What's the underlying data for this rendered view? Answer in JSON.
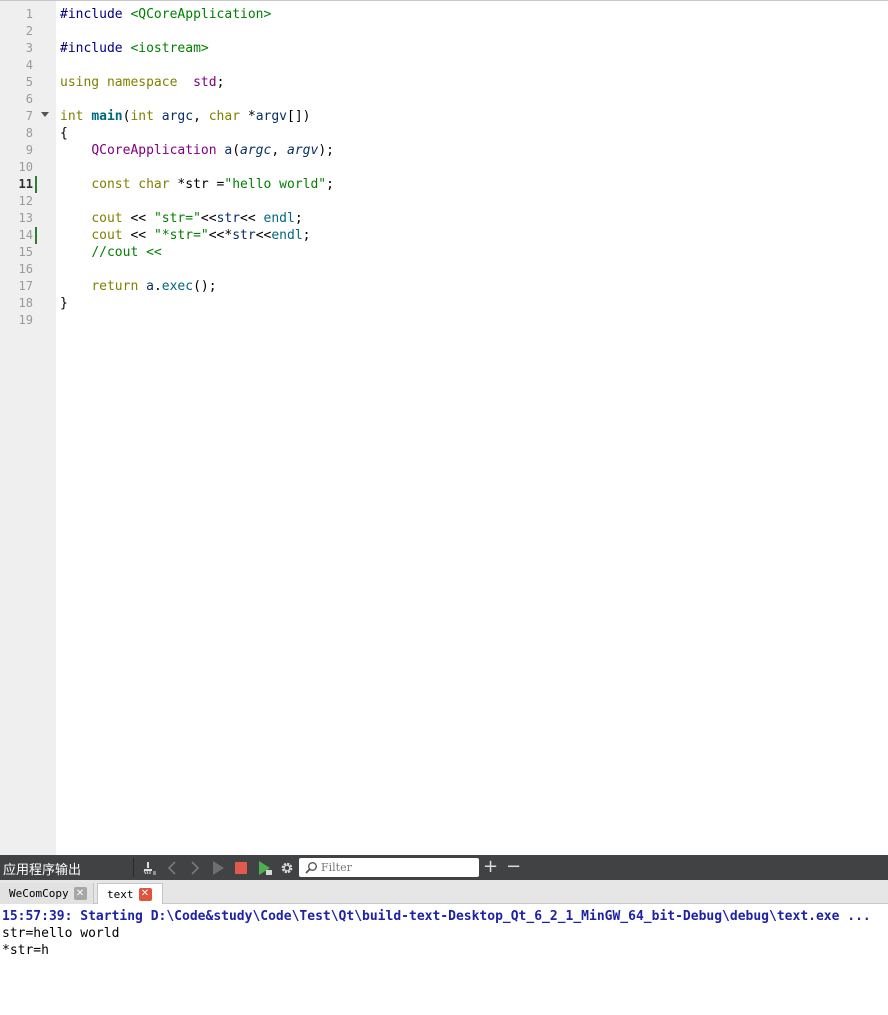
{
  "editor": {
    "line_numbers": [
      "1",
      "2",
      "3",
      "4",
      "5",
      "6",
      "7",
      "8",
      "9",
      "10",
      "11",
      "12",
      "13",
      "14",
      "15",
      "16",
      "17",
      "18",
      "19"
    ],
    "current_line": "11",
    "code": {
      "l1_directive": "#include ",
      "l1_header": "<QCoreApplication>",
      "l3_directive": "#include ",
      "l3_header": "<iostream>",
      "l5_using": "using",
      "l5_namespace": "namespace",
      "l5_std": "std",
      "l5_semicolon": ";",
      "l7_int": "int",
      "l7_main": "main",
      "l7_open": "(",
      "l7_int2": "int",
      "l7_argc": "argc",
      "l7_comma": ", ",
      "l7_char": "char",
      "l7_star": " *",
      "l7_argv": "argv",
      "l7_close": "[])",
      "l8": "{",
      "l9_class": "QCoreApplication",
      "l9_a": "a",
      "l9_open": "(",
      "l9_argc": "argc",
      "l9_comma": ", ",
      "l9_argv": "argv",
      "l9_close": ");",
      "l11_const": "const",
      "l11_char": "char",
      "l11_rest": " *str =",
      "l11_str": "\"hello world\"",
      "l11_end": ";",
      "l13_cout": "cout",
      "l13_op1": " << ",
      "l13_str": "\"str=\"",
      "l13_op2": "<<",
      "l13_var": "str",
      "l13_op3": "<< ",
      "l13_endl": "endl",
      "l13_end": ";",
      "l14_cout": "cout",
      "l14_op1": " << ",
      "l14_str": "\"*str=\"",
      "l14_op2": "<<*",
      "l14_var": "str",
      "l14_op3": "<<",
      "l14_endl": "endl",
      "l14_end": ";",
      "l15_comment": "//cout <<",
      "l17_return": "return",
      "l17_a": "a",
      "l17_dot": ".",
      "l17_exec": "exec",
      "l17_end": "();",
      "l18": "}"
    }
  },
  "output_pane": {
    "title": "应用程序输出",
    "filter_placeholder": "Filter",
    "icons": [
      "clean-icon",
      "prev-icon",
      "next-icon",
      "run-icon",
      "stop-icon",
      "debug-run-icon",
      "settings-icon",
      "filter-icon",
      "add-icon",
      "minus-icon"
    ],
    "add_symbol": "+",
    "minus_symbol": "−",
    "tabs": [
      {
        "label": "WeComCopy",
        "active": false
      },
      {
        "label": "text",
        "active": true
      }
    ],
    "lines": [
      "15:57:39: Starting D:\\Code&study\\Code\\Test\\Qt\\build-text-Desktop_Qt_6_2_1_MinGW_64_bit-Debug\\debug\\text.exe ...",
      "str=hello world",
      "*str=h"
    ]
  },
  "colors": {
    "keyword": "#808000",
    "string": "#008000",
    "preprocessor": "#000080",
    "class": "#800080",
    "function": "#00677c",
    "variable": "#092e64",
    "start_line": "#1e22a8",
    "stop_button": "#e05a4f",
    "active_tab_close": "#e0533d"
  }
}
